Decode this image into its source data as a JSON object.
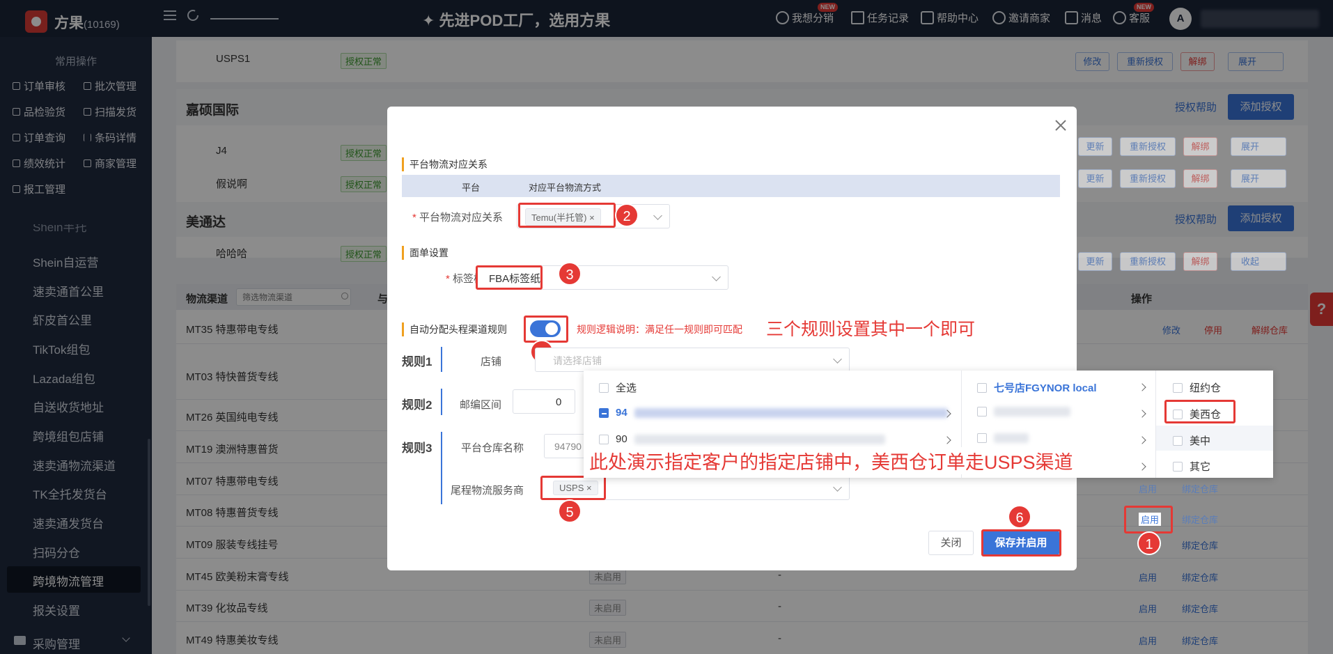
{
  "topbar": {
    "brand": "方果",
    "brand_count": "(10169)",
    "slogan": "✦ 先进POD工厂，选用方果",
    "nav": [
      {
        "label": "我想分销",
        "badge": "NEW"
      },
      {
        "label": "任务记录"
      },
      {
        "label": "帮助中心"
      },
      {
        "label": "邀请商家"
      },
      {
        "label": "消息"
      },
      {
        "label": "客服",
        "badge": "NEW"
      }
    ],
    "avatar_letter": "A"
  },
  "sidebar": {
    "quick_title": "常用操作",
    "quick_items": [
      "订单审核",
      "批次管理",
      "品检验货",
      "扫描发货",
      "订单查询",
      "条码详情",
      "绩效统计",
      "商家管理",
      "报工管理"
    ],
    "items": [
      "Shein半托",
      "Shein自运营",
      "速卖通首公里",
      "虾皮首公里",
      "TikTok组包",
      "Lazada组包",
      "自送收货地址",
      "跨境组包店铺",
      "速卖通物流渠道",
      "TK全托发货台",
      "速卖通发货台",
      "扫码分仓",
      "跨境物流管理",
      "报关设置"
    ],
    "active": "跨境物流管理",
    "bottom_item": "采购管理"
  },
  "content": {
    "top_row": {
      "name": "USPS1",
      "status": "授权正常",
      "actions": [
        "修改",
        "重新授权",
        "解绑",
        "展开"
      ]
    },
    "section1": {
      "title": "嘉硕国际",
      "help": "授权帮助",
      "add": "添加授权",
      "rows": [
        {
          "name": "J4",
          "status": "授权正常",
          "actions": [
            "更新",
            "重新授权",
            "解绑",
            "展开"
          ]
        },
        {
          "name": "假说啊",
          "status": "授权正常",
          "actions": [
            "更新",
            "重新授权",
            "解绑",
            "展开"
          ]
        }
      ]
    },
    "section2": {
      "title": "美通达",
      "help": "授权帮助",
      "add": "添加授权",
      "rows": [
        {
          "name": "哈哈哈",
          "status": "授权正常",
          "actions": [
            "更新",
            "重新授权",
            "解绑",
            "收起"
          ]
        }
      ]
    },
    "table": {
      "col_channel": "物流渠道",
      "filter_placeholder": "筛选物流渠道",
      "col_second": "与",
      "col_ops": "操作",
      "rows": [
        {
          "name": "MT35 特惠带电专线",
          "status": "",
          "acts": [
            "修改",
            "停用",
            "解绑仓库"
          ]
        },
        {
          "name": "MT03 特快普货专线",
          "status": "",
          "acts": []
        },
        {
          "name": "MT26 英国纯电专线",
          "status": "",
          "acts": []
        },
        {
          "name": "MT19 澳洲特惠普货",
          "status": "",
          "acts": []
        },
        {
          "name": "MT07 特惠带电专线",
          "status": "",
          "acts": [
            "启用",
            "绑定仓库"
          ]
        },
        {
          "name": "MT08 特惠普货专线",
          "status": "",
          "acts": [
            "启用",
            "绑定仓库"
          ]
        },
        {
          "name": "MT09 服装专线挂号",
          "status": "",
          "acts": [
            "启用",
            "绑定仓库"
          ]
        },
        {
          "name": "MT45 欧美粉末膏专线",
          "status": "未启用",
          "dash": "-",
          "acts": [
            "启用",
            "绑定仓库"
          ]
        },
        {
          "name": "MT39 化妆品专线",
          "status": "未启用",
          "dash": "-",
          "acts": [
            "启用",
            "绑定仓库"
          ]
        },
        {
          "name": "MT49 特惠美妆专线",
          "status": "未启用",
          "dash": "-",
          "acts": [
            "启用",
            "绑定仓库"
          ]
        }
      ]
    }
  },
  "modal": {
    "section_platform": "平台物流对应关系",
    "th_platform": "平台",
    "th_method": "对应平台物流方式",
    "label_mapping": "平台物流对应关系",
    "mapping_tag": "Temu(半托管)",
    "section_label": "面单设置",
    "label_template": "标签模板",
    "template_value": "FBA标签纸",
    "label_auto": "自动分配头程渠道规则",
    "rule_desc": "规则逻辑说明：满足任一规则即可匹配",
    "rule1": "规则1",
    "rule2": "规则2",
    "rule3": "规则3",
    "label_shop": "店铺",
    "shop_placeholder": "请选择店铺",
    "label_zip": "邮编区间",
    "zip_value": "0",
    "label_warehouse": "平台仓库名称",
    "warehouse_value": "94790",
    "label_carrier": "尾程物流服务商",
    "carrier_tag": "USPS",
    "btn_close": "关闭",
    "btn_save": "保存并启用"
  },
  "dropdown": {
    "col1": [
      {
        "label": "全选",
        "state": "unchecked"
      },
      {
        "label": "94",
        "state": "indeterminate"
      },
      {
        "label": "90",
        "state": "unchecked"
      }
    ],
    "col2": [
      {
        "label": "七号店FGYNOR local",
        "state": "unchecked"
      }
    ],
    "col3": [
      {
        "label": "纽约仓"
      },
      {
        "label": "美西仓"
      },
      {
        "label": "美中"
      },
      {
        "label": "其它"
      }
    ]
  },
  "annotations": {
    "n1": "1",
    "n2": "2",
    "n3": "3",
    "n4": "4",
    "n5": "5",
    "n6": "6",
    "note_rules": "三个规则设置其中一个即可",
    "note_demo": "此处演示指定客户的指定店铺中，美西仓订单走USPS渠道"
  },
  "colors": {
    "topbar": "#1b2538",
    "sidebar": "#1f2a3f",
    "primary": "#3a74d8",
    "danger": "#e53935",
    "accent": "#f0a020"
  }
}
